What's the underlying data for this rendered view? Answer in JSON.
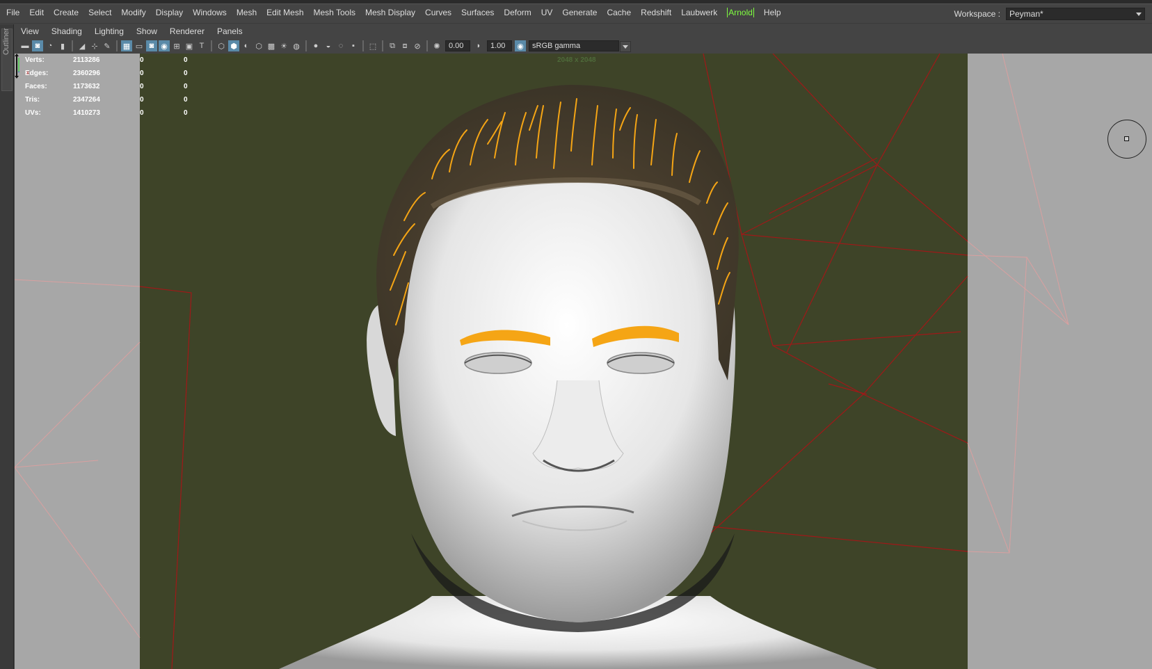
{
  "menubar": {
    "items": [
      "File",
      "Edit",
      "Create",
      "Select",
      "Modify",
      "Display",
      "Windows",
      "Mesh",
      "Edit Mesh",
      "Mesh Tools",
      "Mesh Display",
      "Curves",
      "Surfaces",
      "Deform",
      "UV",
      "Generate",
      "Cache",
      "Redshift",
      "Laubwerk",
      "Arnold",
      "Help"
    ]
  },
  "workspace": {
    "label": "Workspace :",
    "value": "Peyman*"
  },
  "outliner": {
    "label": "Outliner"
  },
  "panel_menu": {
    "items": [
      "View",
      "Shading",
      "Lighting",
      "Show",
      "Renderer",
      "Panels"
    ]
  },
  "toolbar": {
    "exposure": "0.00",
    "gamma": "1.00",
    "color_space": "sRGB gamma"
  },
  "hud": {
    "rows": [
      {
        "label": "Verts:",
        "v1": "2113286",
        "v2": "0",
        "v3": "0"
      },
      {
        "label": "Edges:",
        "v1": "2360296",
        "v2": "0",
        "v3": "0"
      },
      {
        "label": "Faces:",
        "v1": "1173632",
        "v2": "0",
        "v3": "0"
      },
      {
        "label": "Tris:",
        "v1": "2347264",
        "v2": "0",
        "v3": "0"
      },
      {
        "label": "UVs:",
        "v1": "1410273",
        "v2": "0",
        "v3": "0"
      }
    ]
  },
  "viewport": {
    "resolution_gate": "2048 x 2048",
    "background_color": "#3e4428",
    "outside_gate_color": "#a7a7a7",
    "hair_color": "#f5a515"
  }
}
